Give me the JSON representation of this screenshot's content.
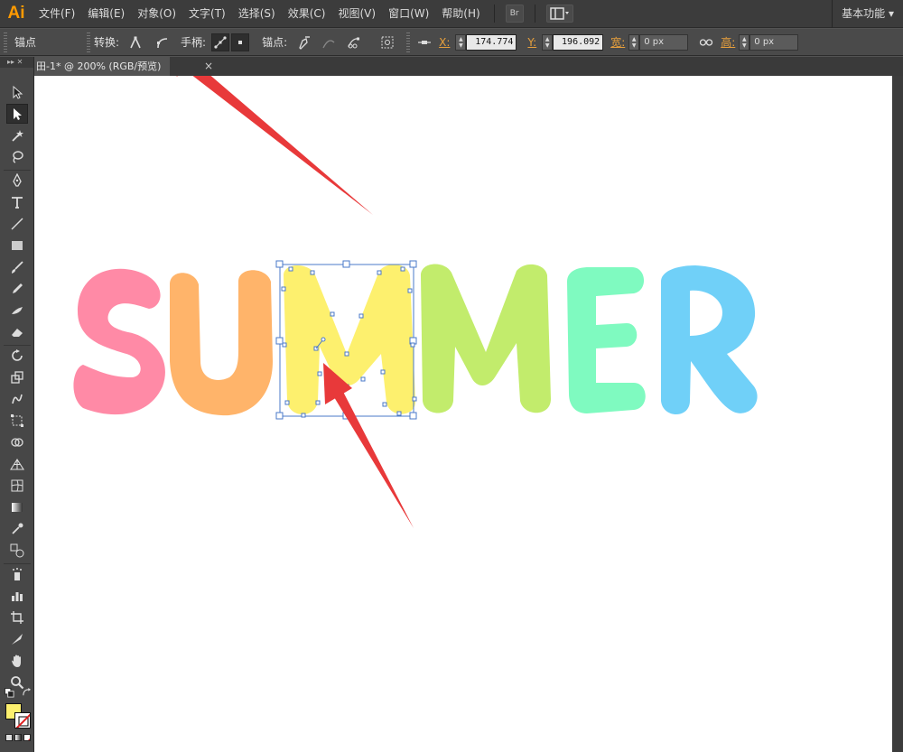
{
  "app": {
    "logo": "Ai",
    "workspace": "基本功能 ▾"
  },
  "menu": [
    "文件(F)",
    "编辑(E)",
    "对象(O)",
    "文字(T)",
    "选择(S)",
    "效果(C)",
    "视图(V)",
    "窗口(W)",
    "帮助(H)"
  ],
  "bridge_button": "Br",
  "control": {
    "panel_label": "锚点",
    "convert_label": "转换:",
    "handles_label": "手柄:",
    "anchors_label": "锚点:",
    "x_label": "X:",
    "x_value": "174.774",
    "y_label": "Y:",
    "y_value": "196.092",
    "w_label": "宽:",
    "w_value": "0 px",
    "h_label": "高:",
    "h_value": "0 px"
  },
  "document_tab": {
    "title": "田-1* @ 200% (RGB/预览)",
    "close": "×"
  },
  "toolbox_header": "▸▸ ✕",
  "artwork": {
    "word": "SUMMER",
    "letters": [
      {
        "char": "S",
        "color": "#ff8aa6"
      },
      {
        "char": "U",
        "color": "#ffb46a"
      },
      {
        "char": "M",
        "color": "#fdf06e"
      },
      {
        "char": "M",
        "color": "#c2ec6c"
      },
      {
        "char": "E",
        "color": "#7ffac0"
      },
      {
        "char": "R",
        "color": "#70d0f8"
      }
    ],
    "selected_letter_index": 2,
    "selection_color": "#4a78c8",
    "arrow_color": "#e8393a"
  },
  "tools": [
    "selection-icon",
    "direct-selection-icon",
    "magic-wand-icon",
    "lasso-icon",
    "pen-icon",
    "type-icon",
    "line-icon",
    "rectangle-icon",
    "paintbrush-icon",
    "pencil-icon",
    "blob-brush-icon",
    "eraser-icon",
    "rotate-icon",
    "scale-icon",
    "warp-icon",
    "free-transform-icon",
    "shape-builder-icon",
    "perspective-grid-icon",
    "mesh-icon",
    "gradient-icon",
    "eyedropper-icon",
    "blend-icon",
    "symbol-sprayer-icon",
    "column-graph-icon",
    "artboard-icon",
    "slice-icon",
    "hand-icon",
    "zoom-icon"
  ],
  "colors": {
    "fill": "#fdf06e",
    "stroke": "none"
  }
}
